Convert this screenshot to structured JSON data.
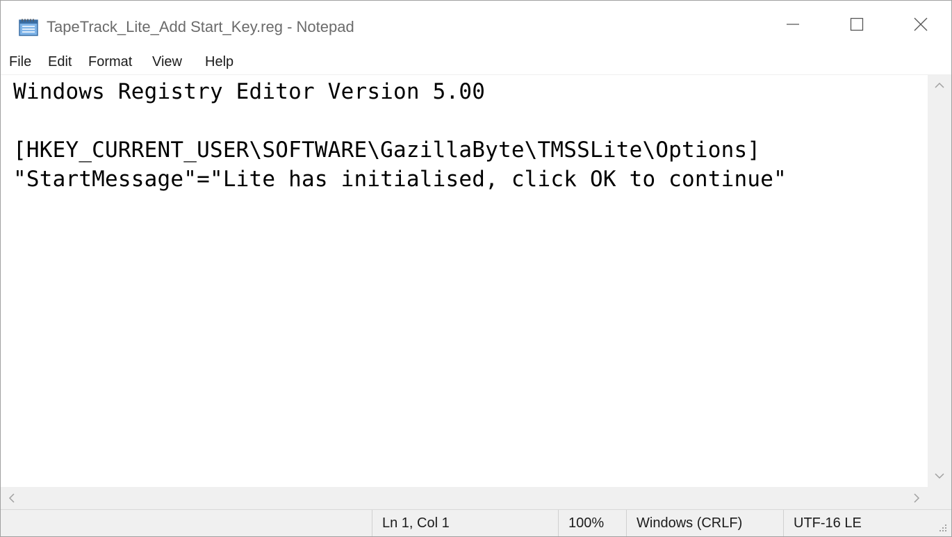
{
  "window": {
    "title": "TapeTrack_Lite_Add Start_Key.reg - Notepad",
    "controls": {
      "minimize": "—",
      "maximize": "☐",
      "close": "✕"
    }
  },
  "menu": {
    "items": [
      "File",
      "Edit",
      "Format",
      "View",
      "Help"
    ]
  },
  "editor": {
    "lines": [
      "Windows Registry Editor Version 5.00",
      "",
      "[HKEY_CURRENT_USER\\SOFTWARE\\GazillaByte\\TMSSLite\\Options]",
      "\"StartMessage\"=\"Lite has initialised, click OK to continue\""
    ]
  },
  "status": {
    "position": "Ln 1, Col 1",
    "zoom": "100%",
    "line_ending": "Windows (CRLF)",
    "encoding": "UTF-16 LE"
  },
  "icons": {
    "app": "notepad-icon",
    "scroll_up": "chevron-up-icon",
    "scroll_down": "chevron-down-icon",
    "scroll_left": "chevron-left-icon",
    "scroll_right": "chevron-right-icon",
    "resize_grip": "resize-grip-icon"
  },
  "colors": {
    "text": "#000000",
    "chrome_text": "#6b6b6b",
    "status_bg": "#f0f0f0"
  }
}
